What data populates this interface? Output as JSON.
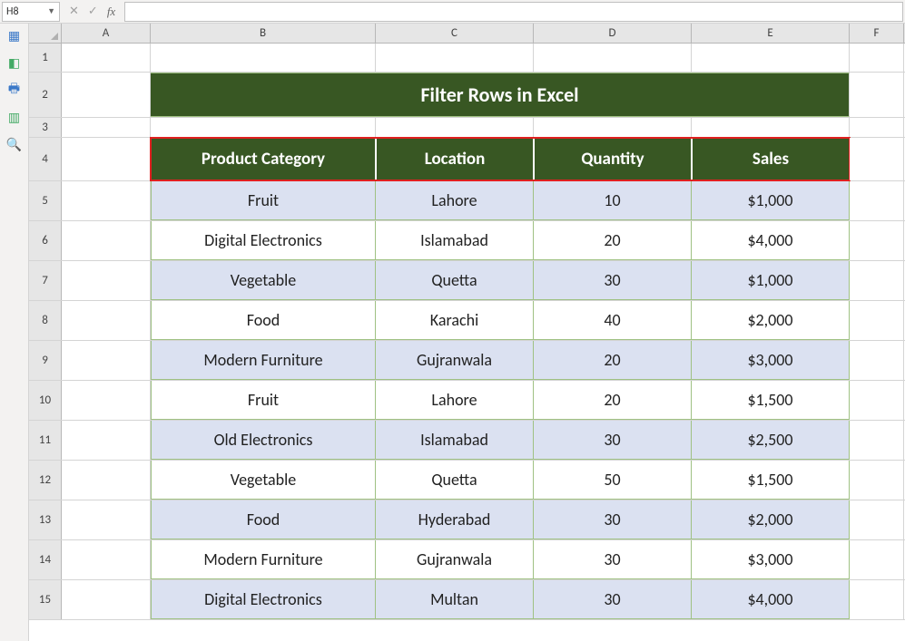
{
  "namebox": "H8",
  "columns": [
    "A",
    "B",
    "C",
    "D",
    "E",
    "F"
  ],
  "row_numbers": [
    "1",
    "2",
    "3",
    "4",
    "5",
    "6",
    "7",
    "8",
    "9",
    "10",
    "11",
    "12",
    "13",
    "14",
    "15"
  ],
  "title": "Filter Rows in Excel",
  "headers": {
    "b": "Product Category",
    "c": "Location",
    "d": "Quantity",
    "e": "Sales"
  },
  "rows": [
    {
      "b": "Fruit",
      "c": "Lahore",
      "d": "10",
      "e": "$1,000"
    },
    {
      "b": "Digital Electronics",
      "c": "Islamabad",
      "d": "20",
      "e": "$4,000"
    },
    {
      "b": "Vegetable",
      "c": "Quetta",
      "d": "30",
      "e": "$1,000"
    },
    {
      "b": "Food",
      "c": "Karachi",
      "d": "40",
      "e": "$2,000"
    },
    {
      "b": "Modern Furniture",
      "c": "Gujranwala",
      "d": "20",
      "e": "$3,000"
    },
    {
      "b": "Fruit",
      "c": "Lahore",
      "d": "20",
      "e": "$1,500"
    },
    {
      "b": "Old Electronics",
      "c": "Islamabad",
      "d": "30",
      "e": "$2,500"
    },
    {
      "b": "Vegetable",
      "c": "Quetta",
      "d": "50",
      "e": "$1,500"
    },
    {
      "b": "Food",
      "c": "Hyderabad",
      "d": "30",
      "e": "$2,000"
    },
    {
      "b": "Modern Furniture",
      "c": "Gujranwala",
      "d": "30",
      "e": "$3,000"
    },
    {
      "b": "Digital Electronics",
      "c": "Multan",
      "d": "30",
      "e": "$4,000"
    }
  ]
}
